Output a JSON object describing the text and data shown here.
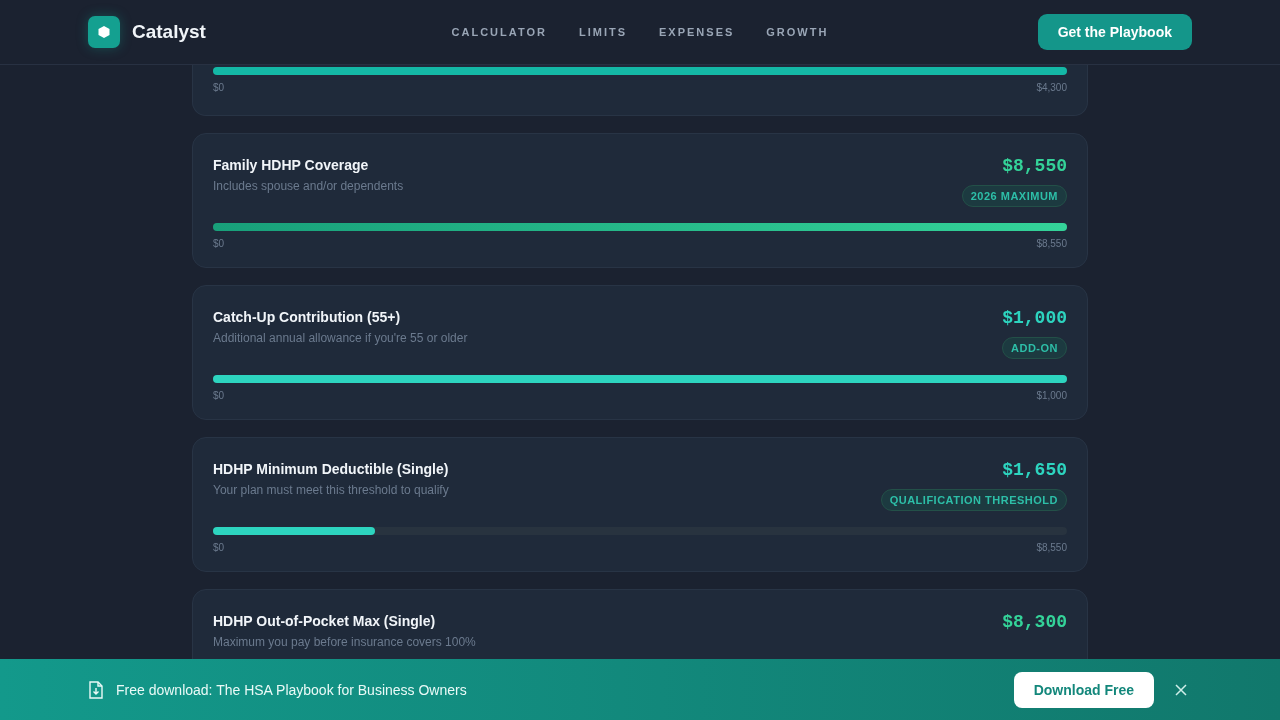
{
  "header": {
    "brand": "Catalyst",
    "nav": [
      {
        "label": "CALCULATOR"
      },
      {
        "label": "LIMITS"
      },
      {
        "label": "EXPENSES"
      },
      {
        "label": "GROWTH"
      }
    ],
    "cta": "Get the Playbook"
  },
  "cards": [
    {
      "kind": "partial",
      "color": "#14b8a6",
      "level": 1,
      "scale_min": "$0",
      "scale_max": "$4,300"
    },
    {
      "kind": "full",
      "title": "Family HDHP Coverage",
      "description": "Includes spouse and/or dependents",
      "amount": "$8,550",
      "badge": "2026 MAXIMUM",
      "color": "#34d399",
      "level": 1,
      "scale_min": "$0",
      "scale_max": "$8,550"
    },
    {
      "kind": "full",
      "title": "Catch-Up Contribution (55+)",
      "description": "Additional annual allowance if you're 55 or older",
      "amount": "$1,000",
      "badge": "ADD-ON",
      "color": "#2dd4bf",
      "level": 1,
      "scale_min": "$0",
      "scale_max": "$1,000"
    },
    {
      "kind": "full",
      "title": "HDHP Minimum Deductible (Single)",
      "description": "Your plan must meet this threshold to qualify",
      "amount": "$1,650",
      "badge": "QUALIFICATION THRESHOLD",
      "color": "#2dd4bf",
      "level": 0.19,
      "scale_min": "$0",
      "scale_max": "$8,550"
    },
    {
      "kind": "cut",
      "title": "HDHP Out-of-Pocket Max (Single)",
      "description": "Maximum you pay before insurance covers 100%",
      "amount": "$8,300",
      "color": "#34d399"
    }
  ],
  "banner": {
    "text": "Free download: The HSA Playbook for Business Owners",
    "button": "Download Free"
  }
}
